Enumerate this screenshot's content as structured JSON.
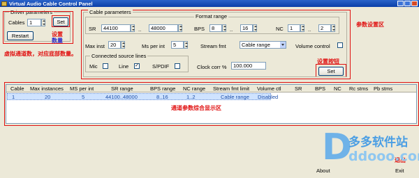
{
  "window": {
    "title": "Virtual Audio Cable Control Panel"
  },
  "driver": {
    "group_title": "Driver parameters",
    "cables_label": "Cables",
    "cables_value": "1",
    "set_label": "Set",
    "restart_label": "Restart"
  },
  "cable": {
    "group_title": "Cable parameters",
    "format_range_label": "Format range",
    "sr_label": "SR",
    "sr_min": "44100",
    "sr_max": "48000",
    "range_sep": "..",
    "bps_label": "BPS",
    "bps_min": "8",
    "bps_max": "16",
    "nc_label": "NC",
    "nc_min": "1",
    "nc_max": "2",
    "max_inst_label": "Max inst",
    "max_inst_value": "20",
    "ms_per_int_label": "Ms per int",
    "ms_per_int_value": "5",
    "stream_fmt_label": "Stream fmt",
    "stream_fmt_value": "Cable range",
    "volume_control_label": "Volume control",
    "connected_title": "Connected source lines",
    "mic_label": "Mic",
    "line_label": "Line",
    "spdif_label": "S/PDIF",
    "clock_corr_label": "Clock corr %",
    "clock_corr_value": "100.000",
    "set_label": "Set",
    "checks": {
      "mic": "",
      "line": "✓",
      "spdif": "",
      "volume": ""
    }
  },
  "table": {
    "headers": [
      "Cable",
      "Max instances",
      "MS per int",
      "SR range",
      "BPS range",
      "NC range",
      "Stream fmt limit",
      "Volume ctl",
      "SR",
      "BPS",
      "NC",
      "Rc stms",
      "Pb stms"
    ],
    "rows": [
      [
        "1",
        "20",
        "5",
        "44100..48000",
        "8..16",
        "1..2",
        "Cable range",
        "Disabled",
        "",
        "",
        "",
        "",
        ""
      ]
    ]
  },
  "buttons": {
    "about": "About",
    "exit": "Exit"
  },
  "annotations": {
    "driver_set": "设置",
    "driver_set2": "数量",
    "driver_note": "虚拟通道数，对应底部数量。",
    "params_area": "参数设置区",
    "set_button": "设置按钮",
    "table_area": "通道参数综合显示区",
    "exit": "退出"
  },
  "watermark": {
    "top": "多多软件站",
    "bottom": "ddooo.com"
  },
  "colors": {
    "annotation": "#e01010",
    "titlebar": "#0a3fa8",
    "selection": "#cfe3ff"
  }
}
